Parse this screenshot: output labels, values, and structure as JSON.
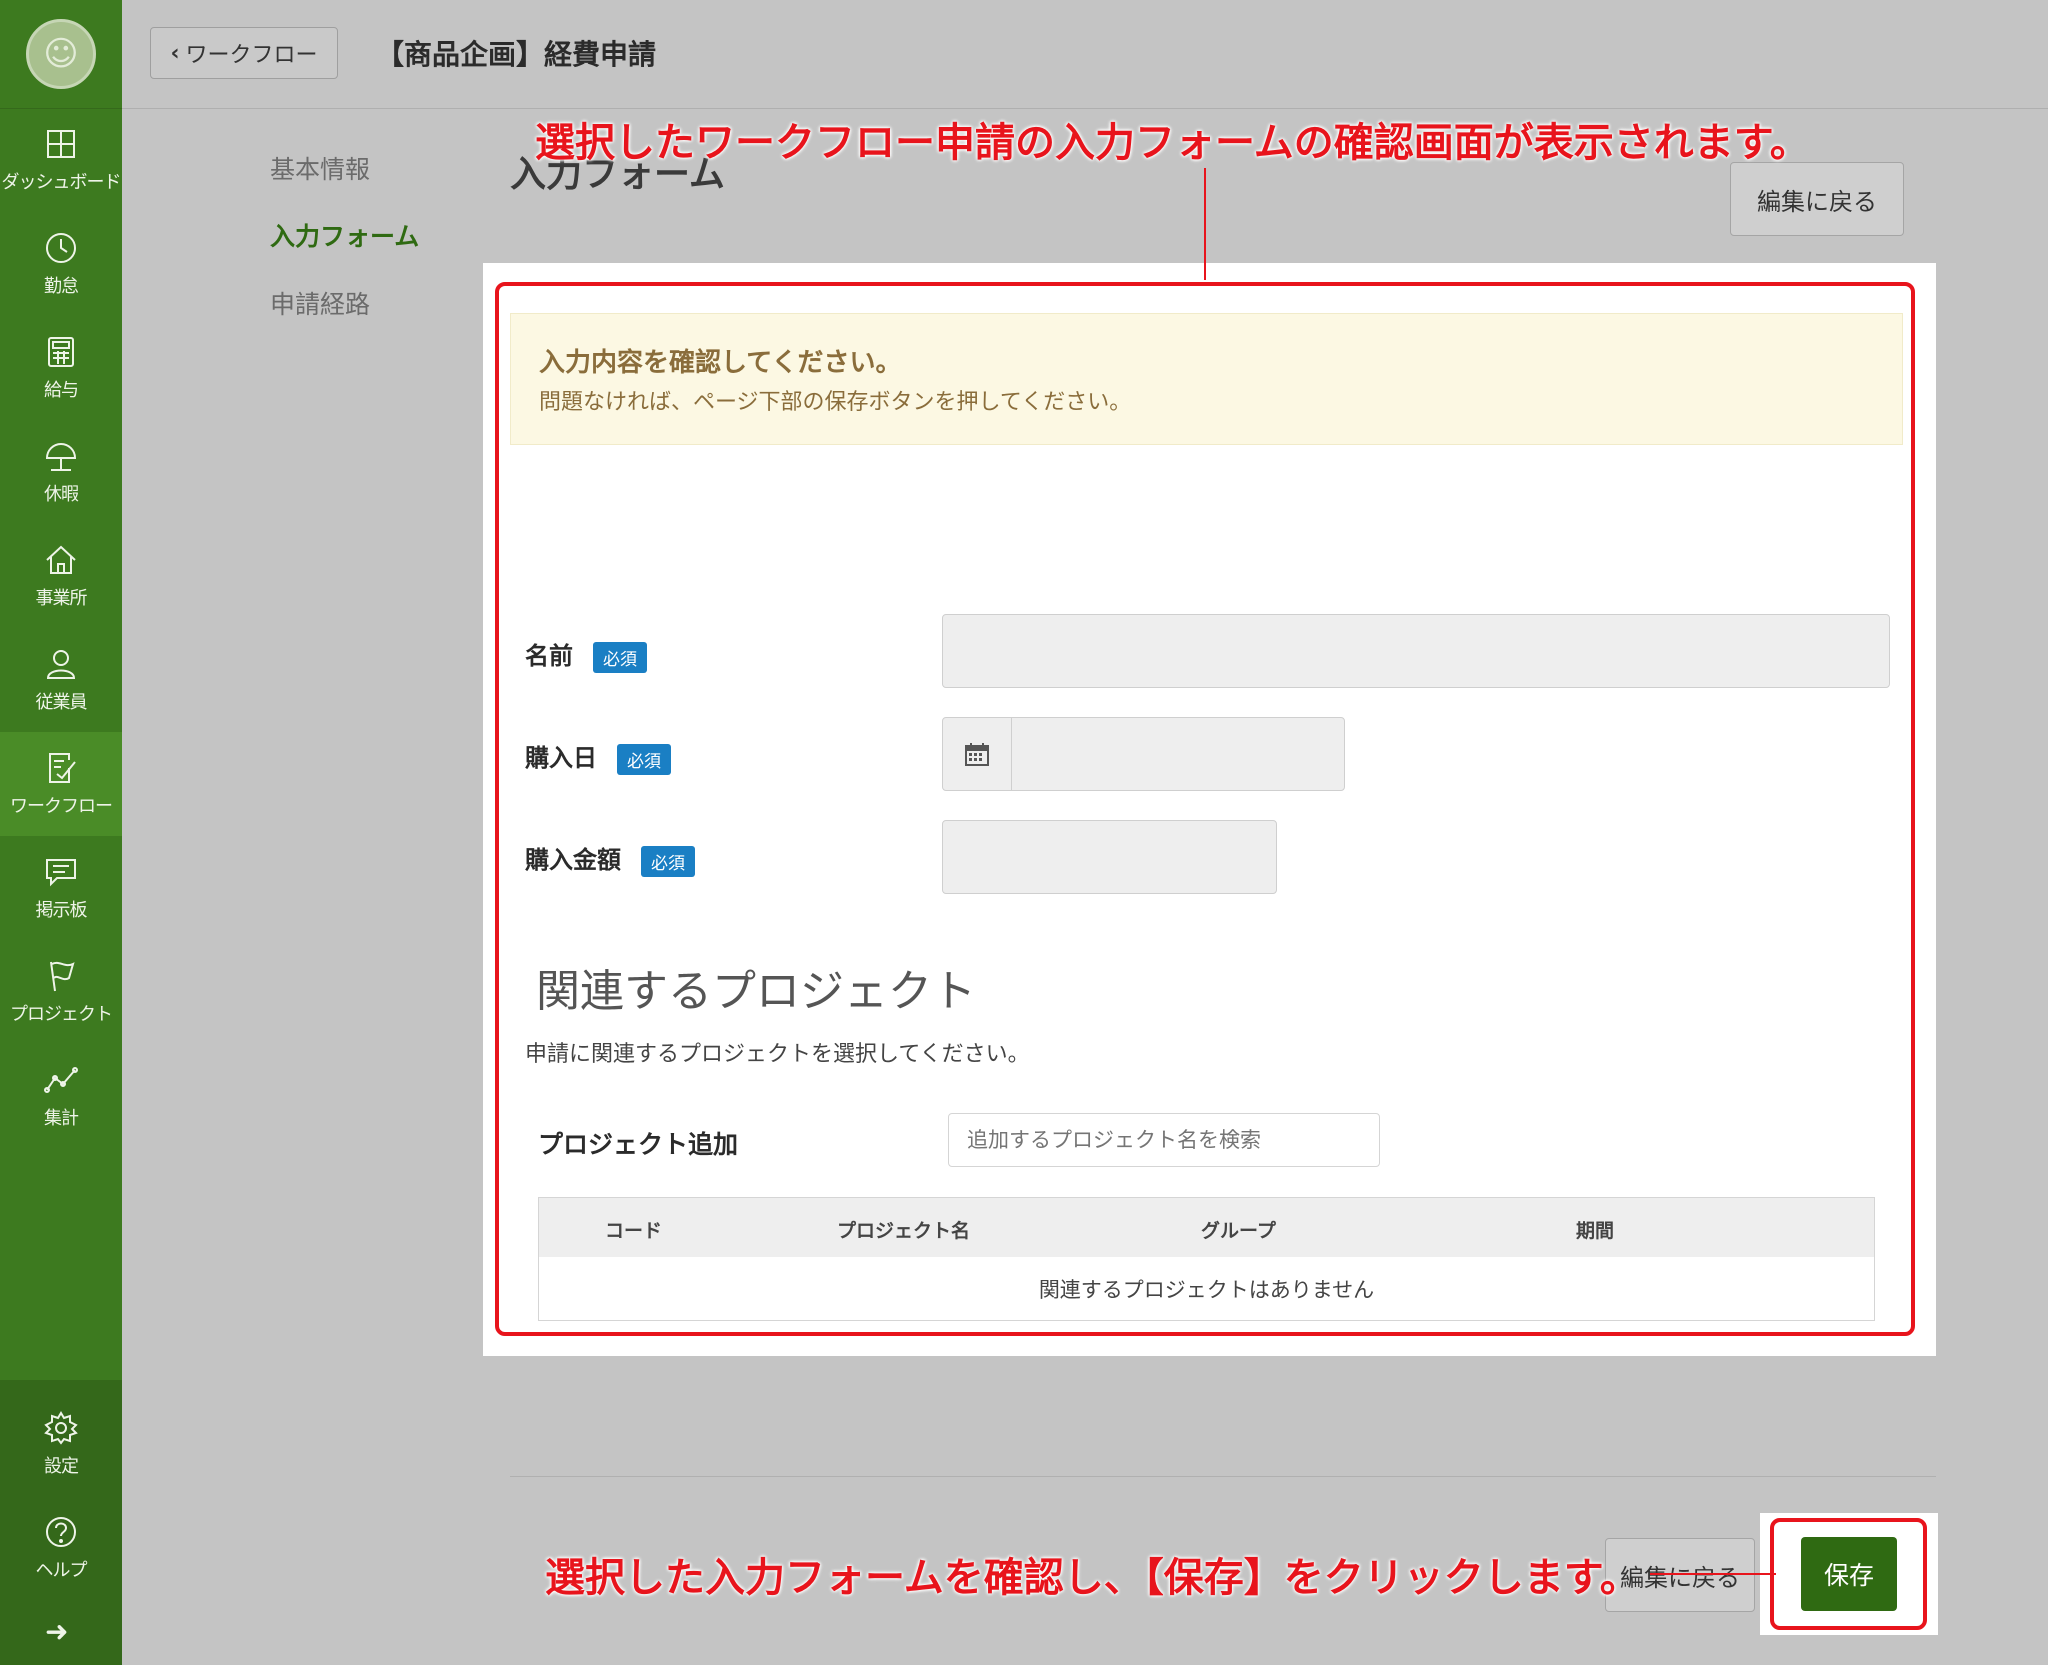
{
  "sidebar": {
    "items": [
      {
        "label": "ダッシュボード",
        "icon": "dashboard-icon"
      },
      {
        "label": "勤怠",
        "icon": "clock-icon"
      },
      {
        "label": "給与",
        "icon": "calculator-icon"
      },
      {
        "label": "休暇",
        "icon": "umbrella-icon"
      },
      {
        "label": "事業所",
        "icon": "home-icon"
      },
      {
        "label": "従業員",
        "icon": "user-icon"
      },
      {
        "label": "ワークフロー",
        "icon": "checklist-icon",
        "active": true
      },
      {
        "label": "掲示板",
        "icon": "message-icon"
      },
      {
        "label": "プロジェクト",
        "icon": "flag-icon"
      },
      {
        "label": "集計",
        "icon": "chart-line-icon"
      }
    ],
    "bottom_items": [
      {
        "label": "設定",
        "icon": "gear-icon"
      },
      {
        "label": "ヘルプ",
        "icon": "help-icon"
      }
    ]
  },
  "header": {
    "back_label": "ワークフロー",
    "title": "【商品企画】経費申請"
  },
  "steps": [
    "基本情報",
    "入力フォーム",
    "申請経路"
  ],
  "section_title": "入力フォーム",
  "edit_back_label": "編集に戻る",
  "alert": {
    "title": "入力内容を確認してください。",
    "text": "問題なければ、ページ下部の保存ボタンを押してください。"
  },
  "required_badge": "必須",
  "fields": {
    "name_label": "名前",
    "purchase_date_label": "購入日",
    "purchase_amount_label": "購入金額"
  },
  "project": {
    "heading": "関連するプロジェクト",
    "description": "申請に関連するプロジェクトを選択してください。",
    "add_label": "プロジェクト追加",
    "search_placeholder": "追加するプロジェクト名を検索",
    "columns": [
      "コード",
      "プロジェクト名",
      "グループ",
      "期間"
    ],
    "empty_text": "関連するプロジェクトはありません"
  },
  "save_label": "保存",
  "annotations": {
    "top": "選択したワークフロー申請の入力フォームの確認画面が表示されます。",
    "bottom": "選択した入力フォームを確認し、【保存】をクリックします。"
  },
  "colors": {
    "sidebar": "#3d7a1f",
    "accent": "#2f6a12",
    "badge": "#1a7fc4",
    "annotation": "#e8141c",
    "alert_bg": "#fcf8e3"
  }
}
